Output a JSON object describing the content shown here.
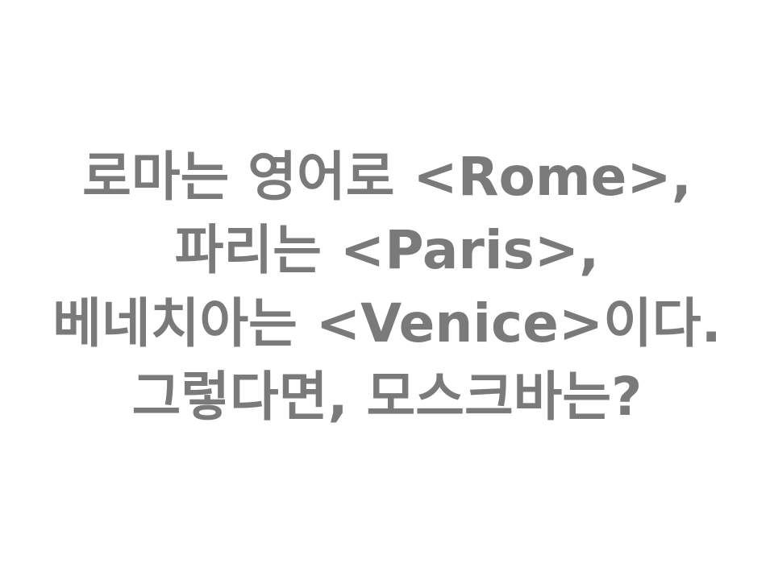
{
  "lines": [
    "로마는 영어로 <Rome>,",
    "파리는 <Paris>,",
    "베네치아는 <Venice>이다.",
    "그렇다면, 모스크바는?"
  ],
  "colors": {
    "text": "#7a7a7a",
    "background": "#ffffff"
  }
}
